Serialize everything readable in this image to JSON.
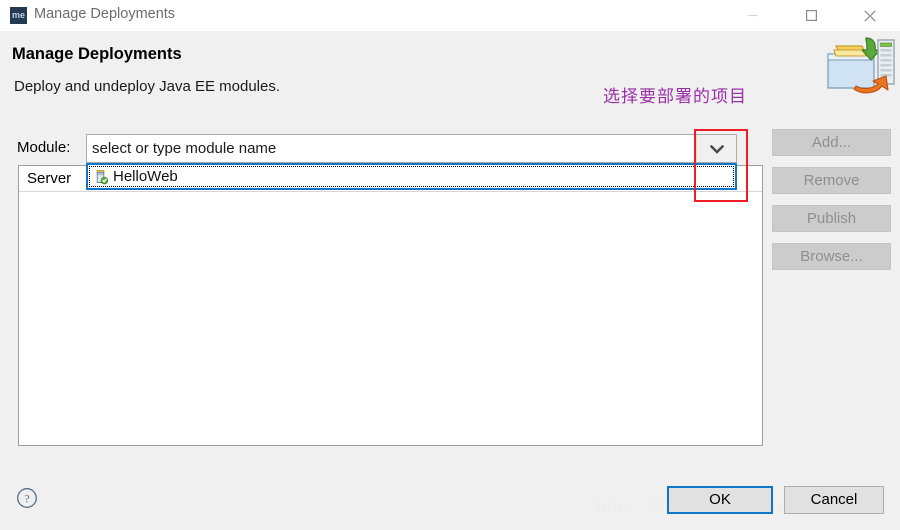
{
  "window": {
    "title": "Manage Deployments",
    "icon_name": "me-app-icon",
    "icon_text": "me",
    "controls": [
      {
        "name": "minimize-button",
        "glyph": "minimize"
      },
      {
        "name": "maximize-button",
        "glyph": "maximize"
      },
      {
        "name": "close-button",
        "glyph": "close"
      }
    ]
  },
  "header": {
    "title": "Manage Deployments",
    "description": "Deploy and undeploy Java EE modules.",
    "banner_icon_name": "deployment-banner-icon"
  },
  "annotations": {
    "chinese_note": "选择要部署的项目",
    "chinese_note_color": "#9b2fa8",
    "highlight_color": "#ee1c25",
    "highlight_name": "dropdown-highlight-rectangle"
  },
  "module": {
    "label": "Module:",
    "input_value": "select or type module name",
    "input_placeholder": "select or type module name",
    "dropdown_arrow_name": "chevron-down-icon",
    "options": [
      {
        "label": "HelloWeb",
        "icon_name": "war-module-icon",
        "selected": true
      }
    ]
  },
  "server_table": {
    "columns": [
      "Server",
      "",
      "",
      "",
      ""
    ],
    "rows": []
  },
  "side_buttons": [
    {
      "label": "Add...",
      "name": "add-button",
      "enabled": false
    },
    {
      "label": "Remove",
      "name": "remove-button",
      "enabled": false
    },
    {
      "label": "Publish",
      "name": "publish-button",
      "enabled": false
    },
    {
      "label": "Browse...",
      "name": "browse-button",
      "enabled": false
    }
  ],
  "footer": {
    "help_icon_name": "help-icon",
    "ok_label": "OK",
    "cancel_label": "Cancel",
    "watermark": "http://blog.csdn.net/smile_po"
  },
  "colors": {
    "dialog_background": "#f0f0f0",
    "focus_blue": "#1176c6",
    "disabled_text": "#8f8f8f",
    "title_text": "#6d6d6d"
  }
}
